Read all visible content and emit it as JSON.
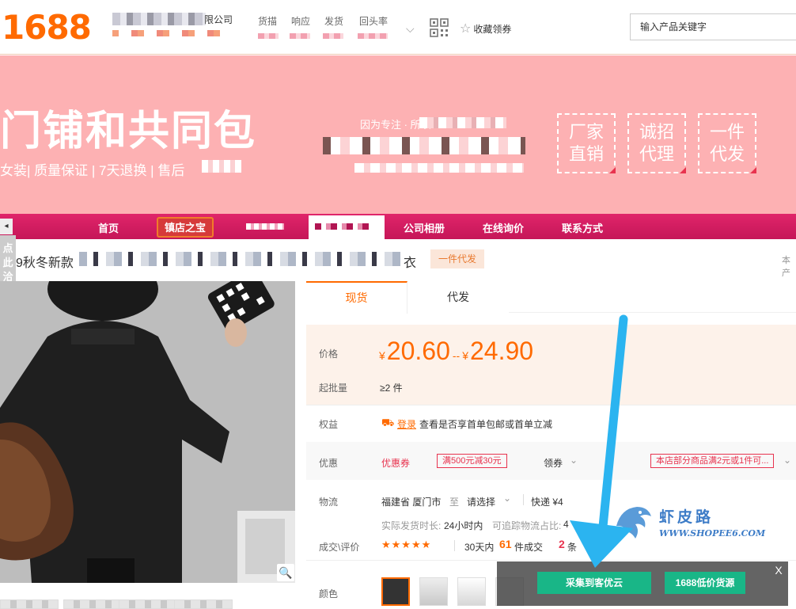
{
  "header": {
    "logo": "1688",
    "shop_suffix": "限公司",
    "metrics": [
      "货描",
      "响应",
      "发货",
      "回头率"
    ],
    "favorite_label": "收藏领券",
    "search_placeholder": "输入产品关键字"
  },
  "banner": {
    "title": "门铺和共同包",
    "subtitle": "女装| 质量保证 | 7天退换 | 售后",
    "prefix_text": "因为专注 · 所以",
    "badges": [
      "厂家直销",
      "诚招代理",
      "一件代发"
    ],
    "accent_color": "#fdb1b3"
  },
  "nav": {
    "left_arrow": "◂",
    "home": "首页",
    "shop_treasure": "镇店之宝",
    "album": "公司相册",
    "inquiry": "在线询价",
    "contact": "联系方式",
    "bar_color": "#d21b60"
  },
  "side_float": "点此洽谈",
  "product": {
    "title_prefix": "9秋冬新款",
    "title_suffix": "衣",
    "dropship_tag": "一件代发",
    "right_edge_text": "本产",
    "tabs": [
      "现货",
      "代发"
    ],
    "price_label": "价格",
    "currency": "¥",
    "price_low": "20.60",
    "price_sep": "--",
    "price_high": "24.90",
    "moq_label": "起批量",
    "moq_value": "≥2 件",
    "rights_label": "权益",
    "login_link": "登录",
    "rights_text": "查看是否享首单包邮或首单立减",
    "discount_label": "优惠",
    "coupon_label": "优惠券",
    "coupon1": "满500元减30元",
    "coupon_more": "领券",
    "coupon2": "本店部分商品满2元或1件可...",
    "logistics_label": "物流",
    "origin": "福建省 厦门市",
    "to": "至",
    "select": "请选择",
    "express": "快递 ¥4",
    "ship_time_label": "实际发货时长:",
    "ship_time_value": "24小时内",
    "trace_label": "可追踪物流占比:",
    "trace_value": "4",
    "review_label": "成交\\评价",
    "stars": "★★★★★",
    "sales_prefix": "30天内",
    "sales_count": "61",
    "sales_suffix": "件成交",
    "review_count": "2",
    "review_suffix": "条",
    "color_label": "颜色",
    "zoom_icon": "🔍"
  },
  "overlay": {
    "collect_button": "采集到客优云",
    "low_price_button": "1688低价货源",
    "close": "X",
    "button_color": "#19b687"
  },
  "watermark": {
    "cn": "虾皮路",
    "url": "WWW.SHOPEE6.COM"
  }
}
